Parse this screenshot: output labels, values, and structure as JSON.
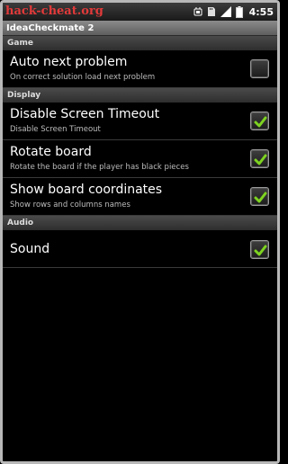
{
  "status_bar": {
    "watermark": "hack-cheat.org",
    "clock": "4:55",
    "icons": [
      "usb-debug-icon",
      "sd-card-icon",
      "signal-icon",
      "battery-icon"
    ]
  },
  "app": {
    "title": "IdeaCheckmate 2"
  },
  "sections": {
    "game": {
      "header": "Game",
      "auto_next": {
        "title": "Auto next problem",
        "summary": "On correct solution load next problem",
        "checked": false
      }
    },
    "display": {
      "header": "Display",
      "screen_timeout": {
        "title": "Disable Screen Timeout",
        "summary": "Disable Screen Timeout",
        "checked": true
      },
      "rotate_board": {
        "title": "Rotate board",
        "summary": "Rotate the board if the player has black pieces",
        "checked": true
      },
      "board_coords": {
        "title": "Show board coordinates",
        "summary": "Show rows and columns names",
        "checked": true
      }
    },
    "audio": {
      "header": "Audio",
      "sound": {
        "title": "Sound",
        "checked": true
      }
    }
  },
  "colors": {
    "check_green": "#7ed321",
    "watermark": "#e23a3a"
  }
}
